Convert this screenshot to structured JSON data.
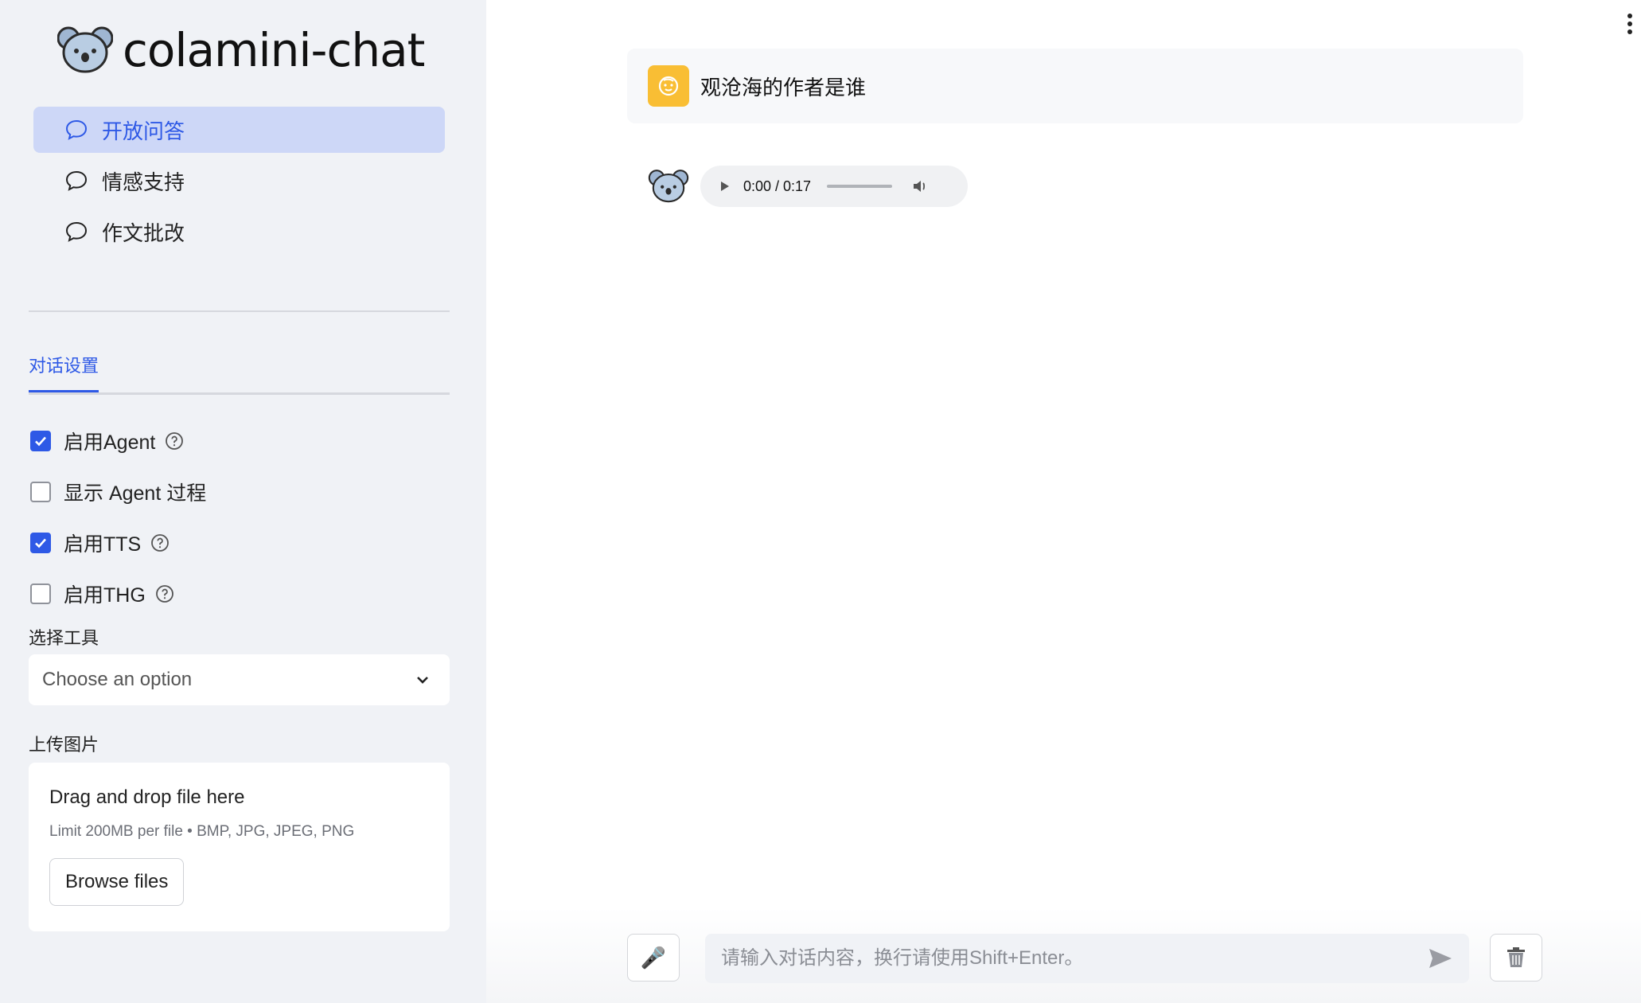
{
  "app": {
    "title": "colamini-chat"
  },
  "nav": {
    "items": [
      {
        "label": "开放问答",
        "active": true
      },
      {
        "label": "情感支持",
        "active": false
      },
      {
        "label": "作文批改",
        "active": false
      }
    ]
  },
  "settings": {
    "tab_label": "对话设置",
    "options": [
      {
        "label": "启用Agent",
        "checked": true,
        "help": true
      },
      {
        "label": "显示 Agent 过程",
        "checked": false,
        "help": false
      },
      {
        "label": "启用TTS",
        "checked": true,
        "help": true
      },
      {
        "label": "启用THG",
        "checked": false,
        "help": true
      }
    ],
    "tool_label": "选择工具",
    "tool_placeholder": "Choose an option",
    "upload_label": "上传图片",
    "upload_title": "Drag and drop file here",
    "upload_limit": "Limit 200MB per file • BMP, JPG, JPEG, PNG",
    "browse_label": "Browse files"
  },
  "chat": {
    "user_message": "观沧海的作者是谁",
    "audio_time": "0:00 / 0:17",
    "input_placeholder": "请输入对话内容，换行请使用Shift+Enter。",
    "mic_icon": "🎤"
  },
  "colors": {
    "accent": "#2e59e6",
    "sidebar_bg": "#f0f2f6",
    "active_nav_bg": "#cdd7f7",
    "user_avatar_bg": "#f9be34"
  }
}
